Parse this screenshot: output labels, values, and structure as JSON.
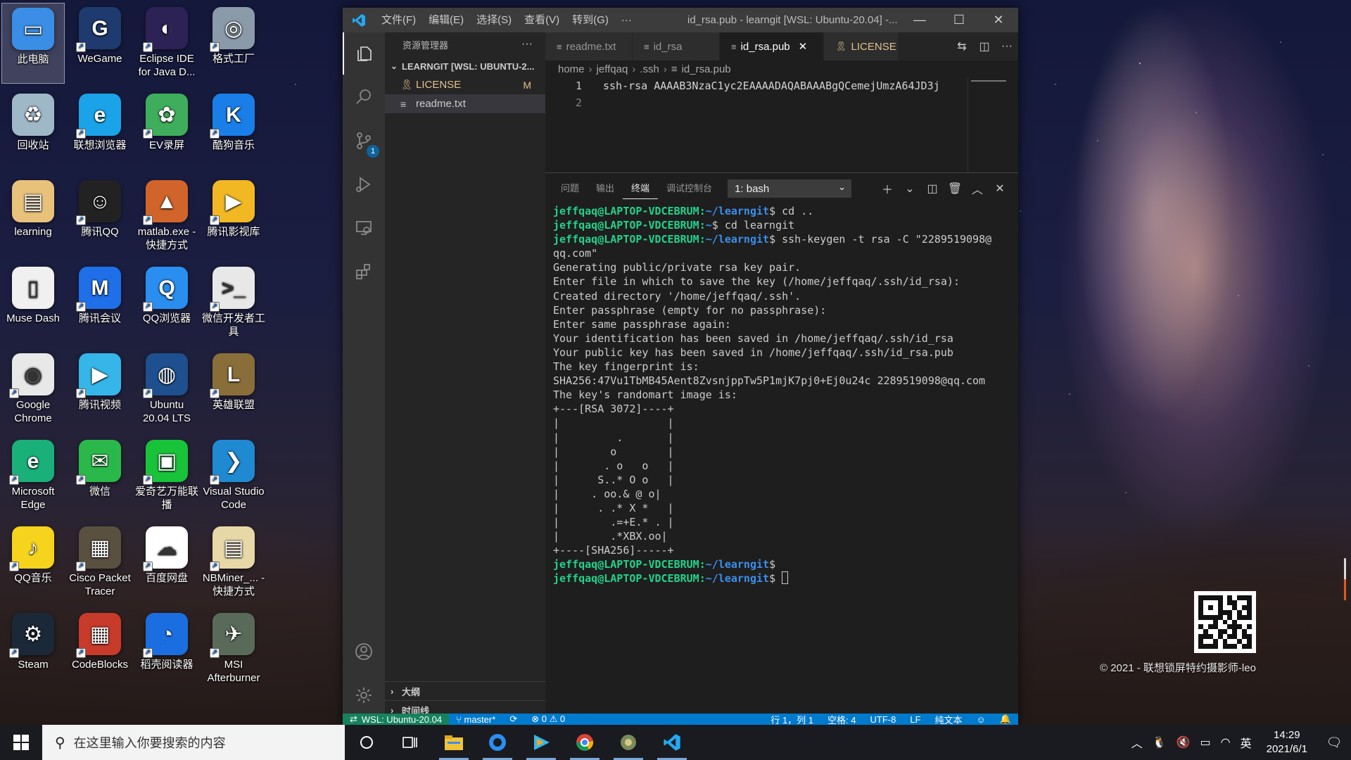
{
  "desktop": {
    "icons": [
      {
        "label": "此电脑",
        "color": "#3a8ee6",
        "glyph": "▭"
      },
      {
        "label": "WeGame",
        "color": "#1e3a6e",
        "glyph": "G"
      },
      {
        "label": "Eclipse IDE for Java D...",
        "color": "#2c2255",
        "glyph": "◐"
      },
      {
        "label": "格式工厂",
        "color": "#8a9aa8",
        "glyph": "◎"
      },
      {
        "label": "回收站",
        "color": "#9fb8c8",
        "glyph": "♻"
      },
      {
        "label": "联想浏览器",
        "color": "#1aa3e8",
        "glyph": "e"
      },
      {
        "label": "EV录屏",
        "color": "#3fae5c",
        "glyph": "✿"
      },
      {
        "label": "酷狗音乐",
        "color": "#1a7ee8",
        "glyph": "K"
      },
      {
        "label": "learning",
        "color": "#e8c27a",
        "glyph": "▤"
      },
      {
        "label": "腾讯QQ",
        "color": "#222222",
        "glyph": "☺"
      },
      {
        "label": "matlab.exe - 快捷方式",
        "color": "#d0642a",
        "glyph": "▲"
      },
      {
        "label": "腾讯影视库",
        "color": "#f2b824",
        "glyph": "▶"
      },
      {
        "label": "Muse Dash",
        "color": "#f0f0f0",
        "glyph": "▯"
      },
      {
        "label": "腾讯会议",
        "color": "#1f6fe8",
        "glyph": "M"
      },
      {
        "label": "QQ浏览器",
        "color": "#2a8ef0",
        "glyph": "Q"
      },
      {
        "label": "微信开发者工具",
        "color": "#e8e8e8",
        "glyph": ">_"
      },
      {
        "label": "Google Chrome",
        "color": "#e8e8e8",
        "glyph": "◉"
      },
      {
        "label": "腾讯视频",
        "color": "#36b6e8",
        "glyph": "▶"
      },
      {
        "label": "Ubuntu 20.04 LTS",
        "color": "#1e4f8e",
        "glyph": "◍"
      },
      {
        "label": "英雄联盟",
        "color": "#8a6e3a",
        "glyph": "L"
      },
      {
        "label": "Microsoft Edge",
        "color": "#1ab07a",
        "glyph": "e"
      },
      {
        "label": "微信",
        "color": "#2ab84a",
        "glyph": "✉"
      },
      {
        "label": "爱奇艺万能联播",
        "color": "#18c33a",
        "glyph": "▣"
      },
      {
        "label": "Visual Studio Code",
        "color": "#1f8ad2",
        "glyph": "❯"
      },
      {
        "label": "QQ音乐",
        "color": "#f6d31c",
        "glyph": "♪"
      },
      {
        "label": "Cisco Packet Tracer",
        "color": "#5a5040",
        "glyph": "▦"
      },
      {
        "label": "百度网盘",
        "color": "#ffffff",
        "glyph": "☁"
      },
      {
        "label": "NBMiner_... - 快捷方式",
        "color": "#e8d8a8",
        "glyph": "▤"
      },
      {
        "label": "Steam",
        "color": "#1b2838",
        "glyph": "⚙"
      },
      {
        "label": "CodeBlocks",
        "color": "#c83a2a",
        "glyph": "▦"
      },
      {
        "label": "稻壳阅读器",
        "color": "#1a6ee0",
        "glyph": "◔"
      },
      {
        "label": "MSI Afterburner",
        "color": "#5a6a5a",
        "glyph": "✈"
      }
    ]
  },
  "vscode": {
    "menu": [
      "文件(F)",
      "编辑(E)",
      "选择(S)",
      "查看(V)",
      "转到(G)",
      "···"
    ],
    "window_title": "id_rsa.pub - learngit [WSL: Ubuntu-20.04] -...",
    "sidebar": {
      "title": "资源管理器",
      "folder": "LEARNGIT [WSL: UBUNTU-2...",
      "files": [
        {
          "name": "LICENSE",
          "status": "M"
        },
        {
          "name": "readme.txt",
          "status": ""
        }
      ],
      "outline": "大纲",
      "timeline": "时间线"
    },
    "tabs": [
      {
        "label": "readme.txt"
      },
      {
        "label": "id_rsa"
      },
      {
        "label": "id_rsa.pub"
      },
      {
        "label": "LICENSE"
      }
    ],
    "breadcrumb": [
      "home",
      "jeffqaq",
      ".ssh",
      "id_rsa.pub"
    ],
    "editor": {
      "lines": [
        {
          "num": "1",
          "text": "ssh-rsa AAAAB3NzaC1yc2EAAAADAQABAAABgQCemejUmzA64JD3j"
        },
        {
          "num": "2",
          "text": ""
        }
      ]
    },
    "panel": {
      "tabs": [
        "问题",
        "输出",
        "终端",
        "调试控制台"
      ],
      "terminal_select": "1: bash",
      "prompt_user": "jeffqaq@LAPTOP-VDCEBRUM",
      "lines": [
        {
          "prompt": true,
          "path": "~/learngit",
          "cmd": "$ cd .."
        },
        {
          "prompt": true,
          "path": "~",
          "cmd": "$ cd learngit"
        },
        {
          "prompt": true,
          "path": "~/learngit",
          "cmd": "$ ssh-keygen -t rsa -C \"2289519098@"
        },
        {
          "prompt": false,
          "text": "qq.com\""
        },
        {
          "prompt": false,
          "text": "Generating public/private rsa key pair."
        },
        {
          "prompt": false,
          "text": "Enter file in which to save the key (/home/jeffqaq/.ssh/id_rsa):"
        },
        {
          "prompt": false,
          "text": "Created directory '/home/jeffqaq/.ssh'."
        },
        {
          "prompt": false,
          "text": "Enter passphrase (empty for no passphrase):"
        },
        {
          "prompt": false,
          "text": "Enter same passphrase again:"
        },
        {
          "prompt": false,
          "text": "Your identification has been saved in /home/jeffqaq/.ssh/id_rsa"
        },
        {
          "prompt": false,
          "text": "Your public key has been saved in /home/jeffqaq/.ssh/id_rsa.pub"
        },
        {
          "prompt": false,
          "text": "The key fingerprint is:"
        },
        {
          "prompt": false,
          "text": "SHA256:47Vu1TbMB45Aent8ZvsnjppTw5P1mjK7pj0+Ej0u24c 2289519098@qq.com"
        },
        {
          "prompt": false,
          "text": "The key's randomart image is:"
        },
        {
          "prompt": false,
          "text": "+---[RSA 3072]----+"
        },
        {
          "prompt": false,
          "text": "|                 |"
        },
        {
          "prompt": false,
          "text": "|         .       |"
        },
        {
          "prompt": false,
          "text": "|        o        |"
        },
        {
          "prompt": false,
          "text": "|       . o   o   |"
        },
        {
          "prompt": false,
          "text": "|      S..* O o   |"
        },
        {
          "prompt": false,
          "text": "|     . oo.& @ o| "
        },
        {
          "prompt": false,
          "text": "|      . .* X *   |"
        },
        {
          "prompt": false,
          "text": "|        .=+E.* . |"
        },
        {
          "prompt": false,
          "text": "|        .*XBX.oo|"
        },
        {
          "prompt": false,
          "text": "+----[SHA256]-----+"
        },
        {
          "prompt": true,
          "path": "~/learngit",
          "cmd": "$"
        },
        {
          "prompt": true,
          "path": "~/learngit",
          "cmd": "$ ",
          "cursor": true
        }
      ]
    },
    "statusbar": {
      "remote": "WSL: Ubuntu-20.04",
      "branch": "master*",
      "problems": "⊗ 0 ⚠ 0",
      "position": "行 1，列 1",
      "spaces": "空格: 4",
      "encoding": "UTF-8",
      "eol": "LF",
      "language": "纯文本"
    }
  },
  "wallpaper": {
    "copyright": "© 2021 - 联想锁屏特约摄影师-leo"
  },
  "taskbar": {
    "search_placeholder": "在这里输入你要搜索的内容",
    "ime": "英",
    "time": "14:29",
    "date": "2021/6/1"
  }
}
